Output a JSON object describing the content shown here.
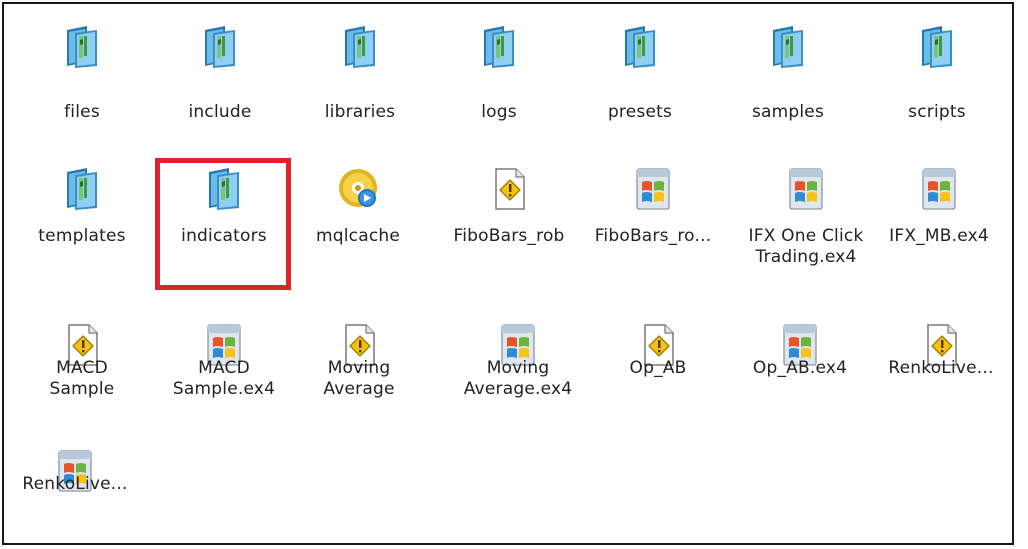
{
  "items": [
    {
      "label": "files",
      "icon": "folder-icon"
    },
    {
      "label": "include",
      "icon": "folder-icon"
    },
    {
      "label": "libraries",
      "icon": "folder-icon"
    },
    {
      "label": "logs",
      "icon": "folder-icon"
    },
    {
      "label": "presets",
      "icon": "folder-icon"
    },
    {
      "label": "samples",
      "icon": "folder-icon"
    },
    {
      "label": "scripts",
      "icon": "folder-icon"
    },
    {
      "label": "templates",
      "icon": "folder-icon"
    },
    {
      "label": "indicators",
      "icon": "folder-icon"
    },
    {
      "label": "mqlcache",
      "icon": "cd-icon"
    },
    {
      "label": "FiboBars_rob",
      "icon": "warning-file-icon"
    },
    {
      "label": "FiboBars_ro...",
      "icon": "windows-app-icon"
    },
    {
      "label": "IFX One Click\nTrading.ex4",
      "icon": "windows-app-icon"
    },
    {
      "label": "IFX_MB.ex4",
      "icon": "windows-app-icon"
    },
    {
      "label": "MACD\nSample",
      "icon": "warning-file-icon"
    },
    {
      "label": "MACD\nSample.ex4",
      "icon": "windows-app-icon"
    },
    {
      "label": "Moving\nAverage",
      "icon": "warning-file-icon"
    },
    {
      "label": "Moving\nAverage.ex4",
      "icon": "windows-app-icon"
    },
    {
      "label": "Op_AB",
      "icon": "warning-file-icon"
    },
    {
      "label": "Op_AB.ex4",
      "icon": "windows-app-icon"
    },
    {
      "label": "RenkoLive...",
      "icon": "warning-file-icon"
    },
    {
      "label": "RenkoLive...",
      "icon": "windows-app-icon"
    }
  ],
  "colors": {
    "highlight": "#d9262b",
    "folder_dark": "#1f6fa6",
    "folder_light": "#5fb4e6",
    "warning_yellow": "#f4c20d"
  }
}
